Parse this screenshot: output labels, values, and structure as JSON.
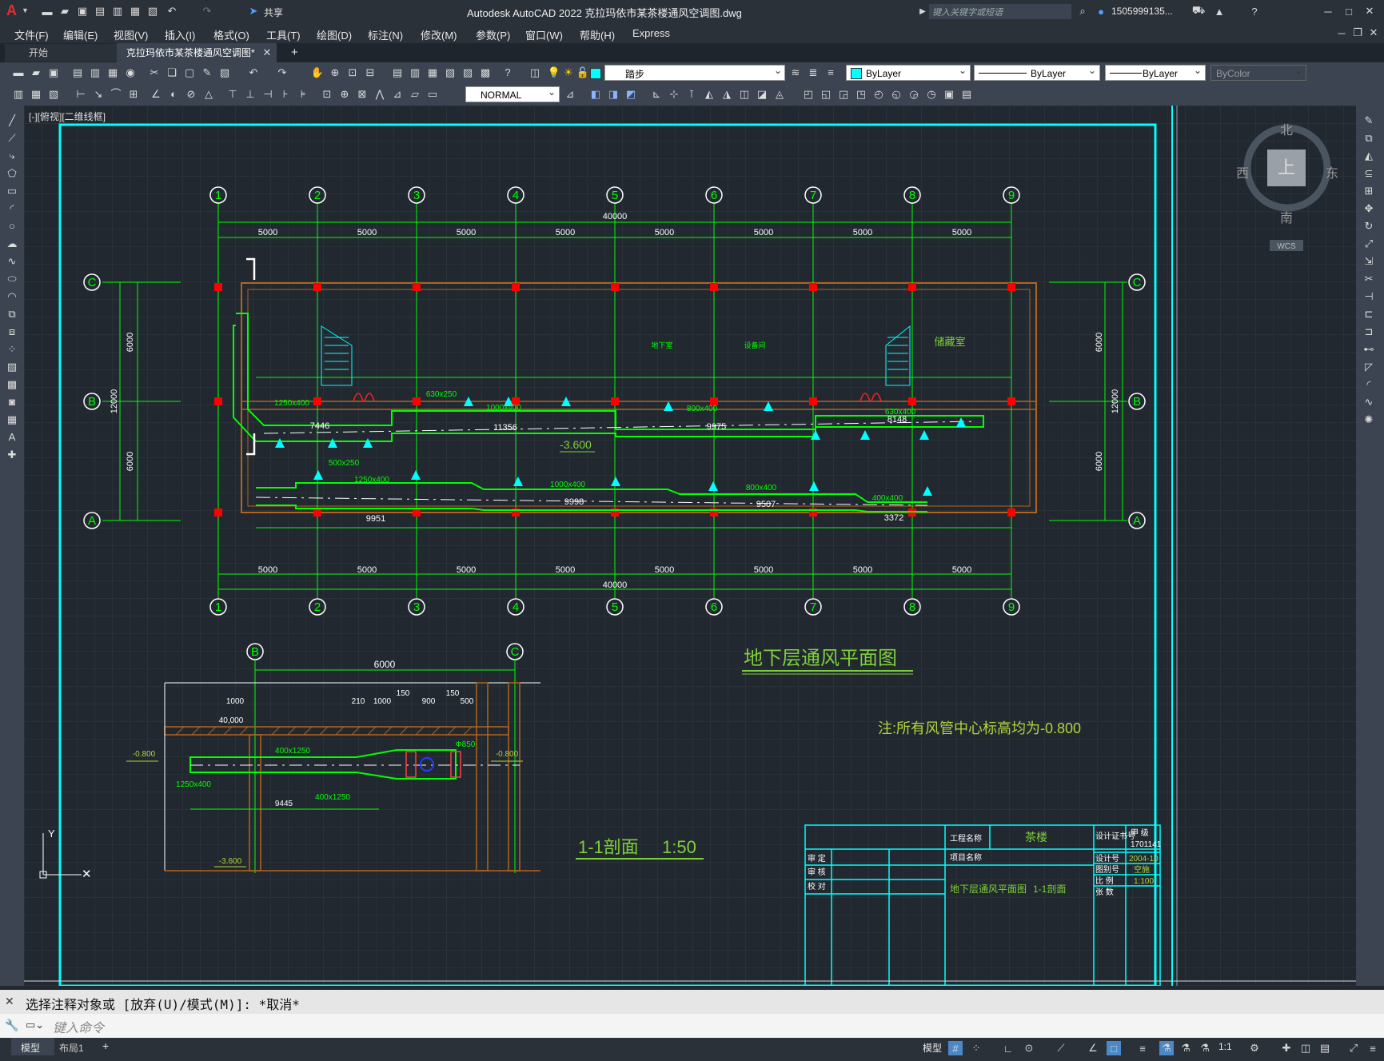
{
  "app": {
    "logo": "A",
    "share_label": "共享",
    "title": "Autodesk AutoCAD 2022    克拉玛依市某茶楼通风空调图.dwg",
    "search_placeholder": "键入关键字或短语",
    "user": "1505999135...",
    "window_controls": [
      "minimize",
      "maximize",
      "close"
    ]
  },
  "menu": {
    "items": [
      "文件(F)",
      "编辑(E)",
      "视图(V)",
      "插入(I)",
      "格式(O)",
      "工具(T)",
      "绘图(D)",
      "标注(N)",
      "修改(M)",
      "参数(P)",
      "窗口(W)",
      "帮助(H)",
      "Express"
    ]
  },
  "tabs": {
    "start": "开始",
    "drawing": "克拉玛依市某茶楼通风空调图*",
    "add": "+"
  },
  "toolbar": {
    "layer_name": "踏步",
    "color": "ByLayer",
    "linetype": "ByLayer",
    "lineweight": "ByLayer",
    "plotstyle": "ByColor",
    "text_style": "NORMAL"
  },
  "viewport": {
    "label": "[-][俯视][二维线框]",
    "viewcube": {
      "north": "北",
      "south": "南",
      "east": "东",
      "west": "西",
      "top": "上",
      "wcs": "WCS"
    }
  },
  "drawing": {
    "axis_columns": [
      "1",
      "2",
      "3",
      "4",
      "5",
      "6",
      "7",
      "8",
      "9"
    ],
    "axis_rows": [
      "C",
      "B",
      "A"
    ],
    "bay_dims": [
      "5000",
      "5000",
      "5000",
      "5000",
      "5000",
      "5000",
      "5000",
      "5000"
    ],
    "total_dim": "40000",
    "row_dims": [
      "6000",
      "6000"
    ],
    "row_total": "12000",
    "duct_lengths_upper": [
      "7446",
      "11356",
      "9975",
      "8148"
    ],
    "duct_lengths_lower": [
      "9951",
      "9998",
      "9507",
      "3372"
    ],
    "duct_sizes": [
      "1250x400",
      "1000x400",
      "800x400",
      "630x400",
      "400x400",
      "630x250",
      "500x250"
    ],
    "elevation_mark": "-3.600",
    "plan_title": "地下层通风平面图",
    "note": "注:所有风管中心标高均为-0.800",
    "section_title": "1-1剖面",
    "section_scale": "1:50",
    "section_axes": [
      "B",
      "C"
    ],
    "section_dim": "6000",
    "section_small_dims": [
      "1000",
      "40,000",
      "210",
      "1000",
      "150",
      "900",
      "150",
      "500"
    ],
    "section_duct_length": "9445",
    "section_elev_left": "-0.800",
    "section_elev_right": "-0.800",
    "section_elev_bottom": "-3.600",
    "section_labels": [
      "400x1250",
      "1250x400",
      "Φ850",
      "400x1250"
    ],
    "title_block": {
      "project_label": "工程名称",
      "project_value": "茶楼",
      "item_label": "项目名称",
      "drawing_name": "地下层通风平面图",
      "drawing_sub": "1-1剖面",
      "rows": [
        "审 定",
        "审 核",
        "校 对"
      ],
      "cert_label": "设计证书号",
      "cert_grade": "甲 级",
      "cert_no": "1701141",
      "design_no_label": "设计号",
      "design_no": "2004-10",
      "drawing_type_label": "图别号",
      "drawing_type": "空施",
      "scale_label": "比 例",
      "scale": "1:100",
      "sheet_label": "张 数"
    },
    "rooms": [
      "地下室",
      "设备间",
      "储藏室"
    ]
  },
  "command": {
    "history": "选择注释对象或 [放弃(U)/模式(M)]: *取消*",
    "placeholder": "键入命令"
  },
  "status": {
    "tabs": [
      "模型",
      "布局1"
    ],
    "add": "+",
    "model_label": "模型",
    "scale": "1:1"
  },
  "colors": {
    "green": "#00ff00",
    "cyan": "#00ffff",
    "magenta": "#ff00ff",
    "red": "#ff0000",
    "brown": "#b2641e",
    "title_green": "#7fcf3a",
    "yellowgreen": "#b5d33d"
  }
}
